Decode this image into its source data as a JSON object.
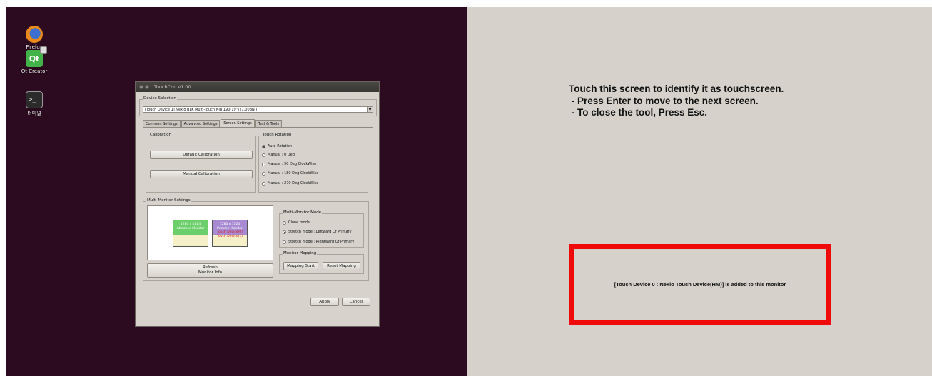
{
  "desktop": {
    "icons": [
      {
        "label": "Firefox"
      },
      {
        "label": "Qt Creator",
        "glyph": "Qt"
      },
      {
        "label": "터미널",
        "glyph": ">_"
      }
    ]
  },
  "dialog": {
    "title": "TouchCon v1.00",
    "device_selection": {
      "group_label": "Device Selection",
      "selected": "[Touch Device 1] Nexio BLK Multi-Touch NIB 190(19\") (1.00BN  )",
      "arrow": "▼"
    },
    "tabs": [
      {
        "label": "Common Settings",
        "active": false
      },
      {
        "label": "Advanced Settings",
        "active": false
      },
      {
        "label": "Screen Settings",
        "active": true
      },
      {
        "label": "Test & Tools",
        "active": false
      }
    ],
    "calibration": {
      "group_label": "Calibration",
      "default_button": "Default Calibration",
      "manual_button": "Manual Calibration"
    },
    "touch_rotation": {
      "group_label": "Touch Rotation",
      "options": [
        {
          "label": "Auto Rotation",
          "selected": true
        },
        {
          "label": "Manual : 0 Deg",
          "selected": false
        },
        {
          "label": "Manual : 90 Deg ClockWise",
          "selected": false
        },
        {
          "label": "Manual : 180 Deg ClockWise",
          "selected": false
        },
        {
          "label": "Manual : 270 Deg ClockWise",
          "selected": false
        }
      ]
    },
    "multi_monitor": {
      "group_label": "Multi-Monitor Settings",
      "monitors": [
        {
          "resolution": "1280 x 1024",
          "name": "Attached Monitor",
          "devices": []
        },
        {
          "resolution": "1280 x 1024",
          "name": "Primary Monitor",
          "devices": [
            "Touch Device(0)",
            "Touch Device(1)"
          ]
        }
      ],
      "refresh_button_line1": "Refresh",
      "refresh_button_line2": "Monitor Info",
      "mode": {
        "group_label": "Multi-Monitor Mode",
        "options": [
          {
            "label": "Clone mode",
            "selected": false
          },
          {
            "label": "Stretch mode : Leftward Of Primary",
            "selected": true
          },
          {
            "label": "Stretch mode : Rightward Of Primary",
            "selected": false
          }
        ]
      },
      "mapping": {
        "group_label": "Monitor Mapping",
        "start_button": "Mapping Start",
        "reset_button": "Reset Mapping"
      }
    },
    "apply_button": "Apply",
    "cancel_button": "Cancel"
  },
  "touch_screen": {
    "instructions": [
      "Touch this screen to identify it as touchscreen.",
      " - Press Enter to move to the next screen.",
      " - To close the tool, Press Esc."
    ],
    "notice": "[Touch Device 0 : Nexio Touch Device(HM)] is added to this monitor",
    "notice_border_color": "#f00a0a"
  }
}
